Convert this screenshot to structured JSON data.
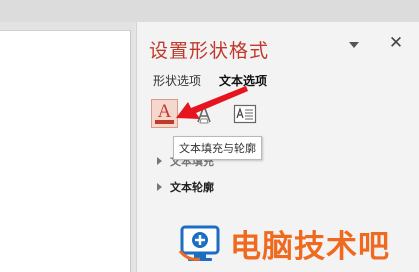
{
  "pane": {
    "title": "设置形状格式",
    "tabs": [
      {
        "label": "形状选项",
        "active": false
      },
      {
        "label": "文本选项",
        "active": true
      }
    ],
    "icons": [
      "text-fill-outline-icon",
      "text-effects-icon",
      "textbox-icon"
    ],
    "tooltip": "文本填充与轮廓",
    "sections": [
      {
        "label": "文本填充",
        "expanded": false
      },
      {
        "label": "文本轮廓",
        "expanded": false
      }
    ]
  },
  "watermark": {
    "text": "电脑技术吧"
  },
  "colors": {
    "accent": "#c0392b",
    "arrow": "#e5141e",
    "watermark": "#ef6a1f",
    "watermark_logo": "#1a6fc4"
  }
}
